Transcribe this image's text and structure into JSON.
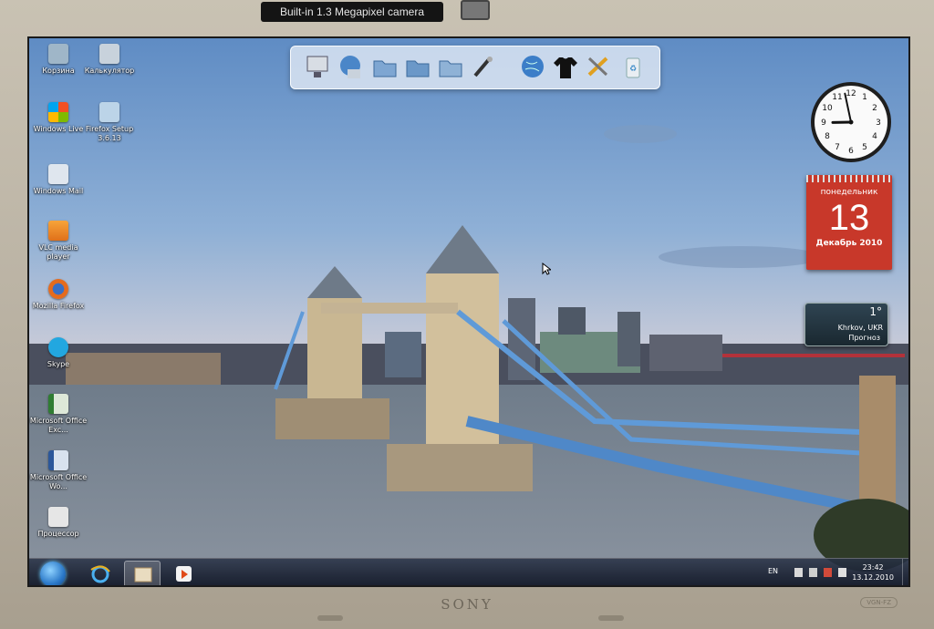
{
  "bezel": {
    "camera_label": "Built-in 1.3 Megapixel camera",
    "brand": "SONY",
    "model": "VGN-FZ"
  },
  "desktop_icons": [
    {
      "label": "Корзина",
      "icon": "recycle-bin-icon",
      "color": "#9fb6c8"
    },
    {
      "label": "Калькулятор",
      "icon": "calculator-icon",
      "color": "#c8d2dc"
    },
    {
      "label": "Windows Live",
      "icon": "windows-live-icon",
      "color": "#e8e8e8"
    },
    {
      "label": "Firefox Setup 3.6.13",
      "icon": "installer-icon",
      "color": "#bcd4e8"
    },
    {
      "label": "Windows Mail",
      "icon": "windows-mail-icon",
      "color": "#dfe6ee"
    },
    {
      "label": "VLC media player",
      "icon": "vlc-icon",
      "color": "#f08a1e"
    },
    {
      "label": "Mozilla Firefox",
      "icon": "firefox-icon",
      "color": "#e56b1d"
    },
    {
      "label": "Skype",
      "icon": "skype-icon",
      "color": "#22a7e0"
    },
    {
      "label": "Microsoft Office Exc...",
      "icon": "excel-icon",
      "color": "#dde8d8"
    },
    {
      "label": "Microsoft Office Wo...",
      "icon": "word-icon",
      "color": "#d8e2ee"
    },
    {
      "label": "Процессор",
      "icon": "processor-icon",
      "color": "#e6e6e6"
    }
  ],
  "dock": [
    {
      "icon": "computer-icon"
    },
    {
      "icon": "network-icon"
    },
    {
      "icon": "folder-icon"
    },
    {
      "icon": "folder-open-icon"
    },
    {
      "icon": "folder-pictures-icon"
    },
    {
      "icon": "tools-icon"
    },
    {
      "icon": "globe-icon"
    },
    {
      "icon": "tshirt-icon"
    },
    {
      "icon": "settings-tools-icon"
    },
    {
      "icon": "trash-icon"
    }
  ],
  "clock_gadget": {
    "hour": 8,
    "minute": 58
  },
  "calendar_gadget": {
    "weekday": "понедельник",
    "day": "13",
    "month_year": "Декабрь 2010"
  },
  "weather_gadget": {
    "temperature": "1°",
    "city": "Khrkov, UKR",
    "forecast": "Прогноз"
  },
  "taskbar": {
    "pinned": [
      {
        "icon": "internet-explorer-icon"
      },
      {
        "icon": "explorer-icon"
      },
      {
        "icon": "media-player-icon"
      }
    ],
    "language": "EN",
    "time": "23:42",
    "date": "13.12.2010"
  }
}
